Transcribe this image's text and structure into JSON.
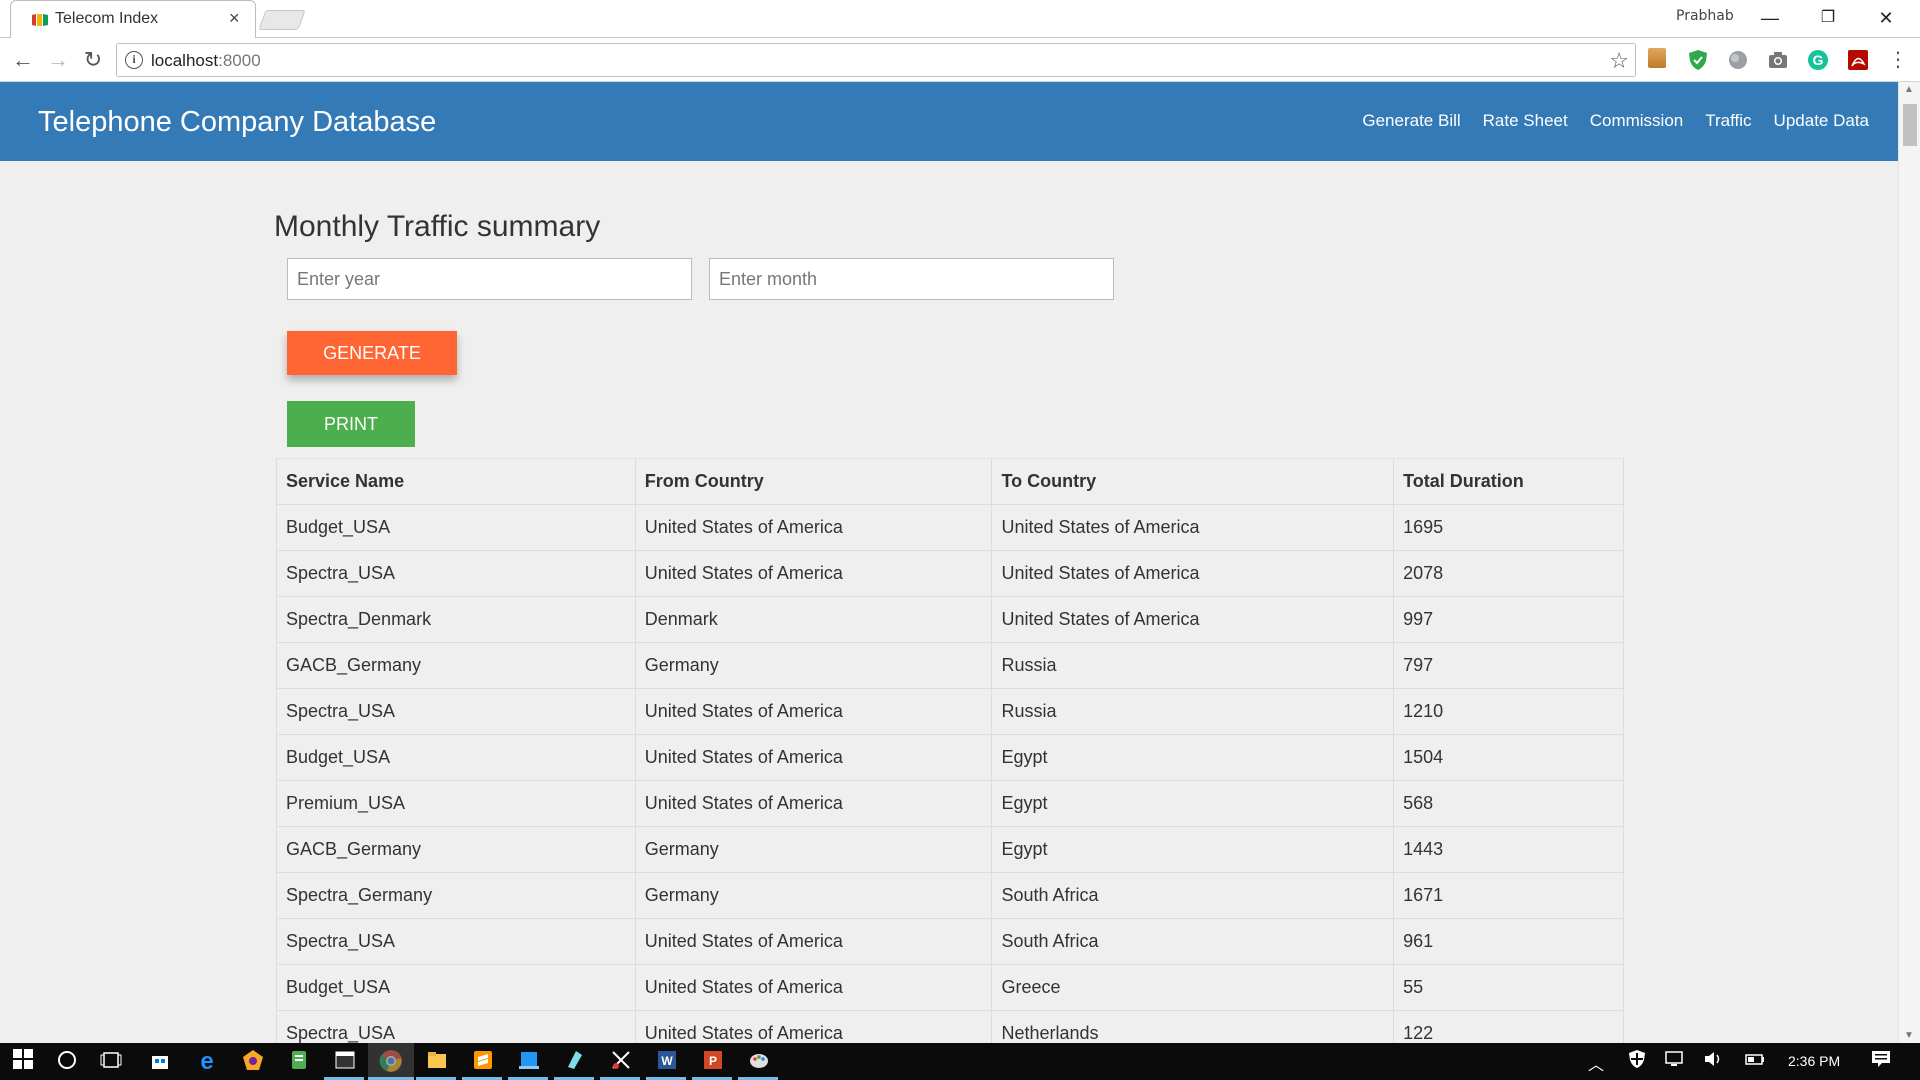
{
  "browser": {
    "tab_title": "Telecom Index",
    "tab_close": "×",
    "profile_name": "Prabhab",
    "window_min": "—",
    "window_restore": "❐",
    "window_close": "✕",
    "url_host": "localhost",
    "url_port": ":8000",
    "back": "←",
    "forward": "→",
    "reload": "↻",
    "star": "☆",
    "info": "i"
  },
  "navbar": {
    "brand": "Telephone Company Database",
    "links": [
      "Generate Bill",
      "Rate Sheet",
      "Commission",
      "Traffic",
      "Update Data"
    ]
  },
  "main": {
    "title": "Monthly Traffic summary",
    "year_placeholder": "Enter year",
    "month_placeholder": "Enter month",
    "generate_label": "GENERATE",
    "print_label": "PRINT"
  },
  "table": {
    "headers": [
      "Service Name",
      "From Country",
      "To Country",
      "Total Duration"
    ],
    "rows": [
      [
        "Budget_USA",
        "United States of America",
        "United States of America",
        "1695"
      ],
      [
        "Spectra_USA",
        "United States of America",
        "United States of America",
        "2078"
      ],
      [
        "Spectra_Denmark",
        "Denmark",
        "United States of America",
        "997"
      ],
      [
        "GACB_Germany",
        "Germany",
        "Russia",
        "797"
      ],
      [
        "Spectra_USA",
        "United States of America",
        "Russia",
        "1210"
      ],
      [
        "Budget_USA",
        "United States of America",
        "Egypt",
        "1504"
      ],
      [
        "Premium_USA",
        "United States of America",
        "Egypt",
        "568"
      ],
      [
        "GACB_Germany",
        "Germany",
        "Egypt",
        "1443"
      ],
      [
        "Spectra_Germany",
        "Germany",
        "South Africa",
        "1671"
      ],
      [
        "Spectra_USA",
        "United States of America",
        "South Africa",
        "961"
      ],
      [
        "Budget_USA",
        "United States of America",
        "Greece",
        "55"
      ],
      [
        "Spectra_USA",
        "United States of America",
        "Netherlands",
        "122"
      ]
    ]
  },
  "taskbar": {
    "time": "2:36 PM"
  },
  "colors": {
    "navbar": "#337ab7",
    "generate": "#ff6633",
    "print": "#4cae4c"
  }
}
